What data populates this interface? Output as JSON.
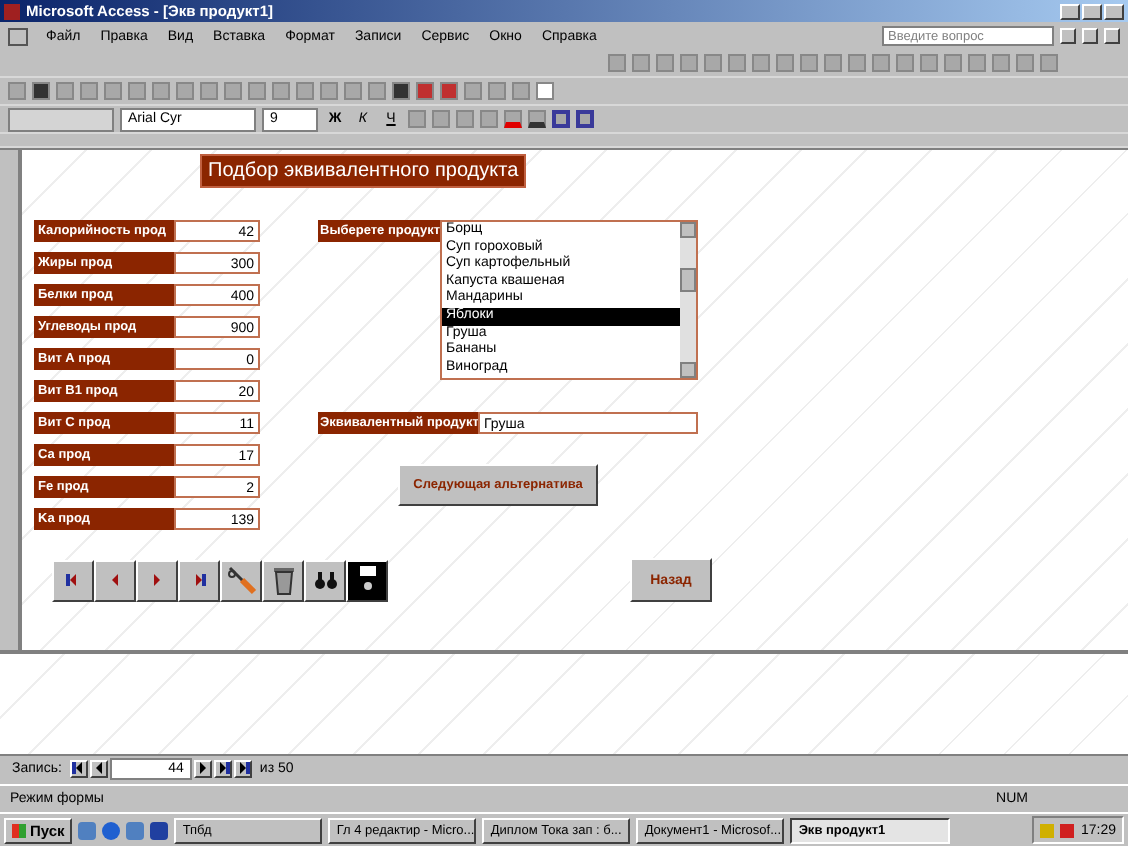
{
  "window": {
    "title": "Microsoft Access - [Экв продукт1]"
  },
  "menu": [
    "Файл",
    "Правка",
    "Вид",
    "Вставка",
    "Формат",
    "Записи",
    "Сервис",
    "Окно",
    "Справка"
  ],
  "help_search": {
    "placeholder": "Введите вопрос"
  },
  "format_toolbar": {
    "font": "Arial Cyr",
    "size": "9",
    "style_buttons": [
      "Ж",
      "К",
      "Ч"
    ]
  },
  "form": {
    "title": "Подбор эквивалентного продукта",
    "fields": [
      {
        "label": "Калорийность прод",
        "value": "42"
      },
      {
        "label": "Жиры прод",
        "value": "300"
      },
      {
        "label": "Белки прод",
        "value": "400"
      },
      {
        "label": "Углеводы прод",
        "value": "900"
      },
      {
        "label": "Вит А прод",
        "value": "0"
      },
      {
        "label": "Вит В1 прод",
        "value": "20"
      },
      {
        "label": "Вит С прод",
        "value": "11"
      },
      {
        "label": "Са прод",
        "value": "17"
      },
      {
        "label": "Fe прод",
        "value": "2"
      },
      {
        "label": "Ka прод",
        "value": "139"
      }
    ],
    "product_list": {
      "label": "Выберете продукт",
      "items": [
        {
          "text": "Борщ",
          "selected": false
        },
        {
          "text": "Суп гороховый",
          "selected": false
        },
        {
          "text": "Суп картофельный",
          "selected": false
        },
        {
          "text": "Капуста квашеная",
          "selected": false
        },
        {
          "text": "Мандарины",
          "selected": false
        },
        {
          "text": "Яблоки",
          "selected": true
        },
        {
          "text": "Груша",
          "selected": false
        },
        {
          "text": "Бананы",
          "selected": false
        },
        {
          "text": "Виноград",
          "selected": false
        }
      ]
    },
    "equivalent": {
      "label": "Эквивалентный продукт",
      "value": "Груша"
    },
    "next_button": "Следующая альтернатива",
    "back_button": "Назад"
  },
  "record_nav": {
    "label": "Запись:",
    "current": "44",
    "total": "из 50"
  },
  "status_bar": {
    "mode": "Режим формы",
    "num": "NUM"
  },
  "taskbar": {
    "start": "Пуск",
    "tasks": [
      {
        "text": "Тпбд",
        "selected": false
      },
      {
        "text": "Гл 4 редактир - Micro...",
        "selected": false
      },
      {
        "text": "Диплом Тока зап : б...",
        "selected": false
      },
      {
        "text": "Документ1 - Microsof...",
        "selected": false
      },
      {
        "text": "Экв продукт1",
        "selected": true
      }
    ],
    "clock": "17:29"
  }
}
